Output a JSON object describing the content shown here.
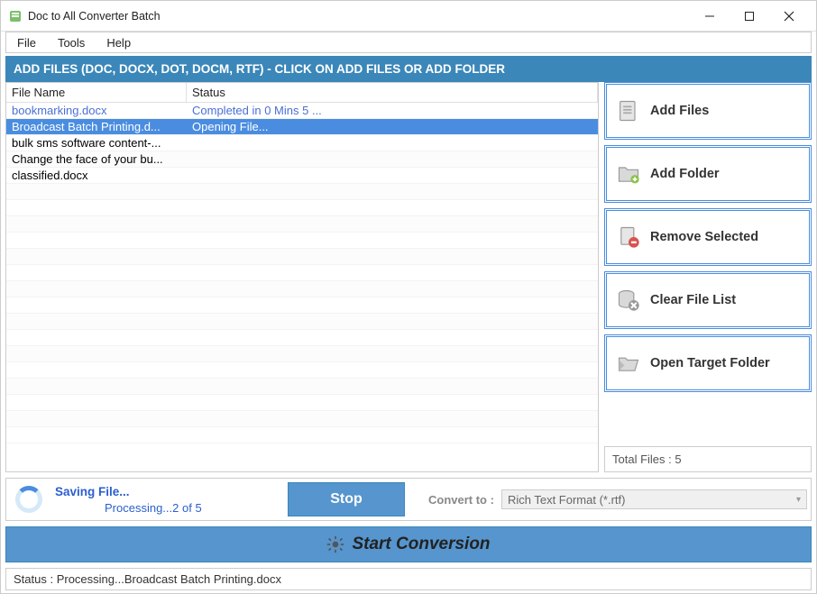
{
  "window": {
    "title": "Doc to All Converter Batch"
  },
  "menu": {
    "items": [
      "File",
      "Tools",
      "Help"
    ]
  },
  "header": {
    "text": "ADD FILES (DOC, DOCX, DOT, DOCM, RTF) - CLICK ON ADD FILES OR ADD FOLDER"
  },
  "table": {
    "columns": {
      "name": "File Name",
      "status": "Status"
    },
    "rows": [
      {
        "name": "bookmarking.docx",
        "status": "Completed in 0 Mins 5 ...",
        "state": "completed"
      },
      {
        "name": "Broadcast Batch Printing.d...",
        "status": "Opening File...",
        "state": "selected"
      },
      {
        "name": "bulk sms software content-...",
        "status": "",
        "state": ""
      },
      {
        "name": "Change the face of your bu...",
        "status": "",
        "state": ""
      },
      {
        "name": "classified.docx",
        "status": "",
        "state": ""
      }
    ]
  },
  "actions": {
    "add_files": "Add Files",
    "add_folder": "Add Folder",
    "remove_selected": "Remove Selected",
    "clear_list": "Clear File List",
    "open_target": "Open Target Folder"
  },
  "total_files": {
    "label": "Total Files : 5"
  },
  "progress": {
    "saving": "Saving File...",
    "processing": "Processing...2 of 5",
    "stop": "Stop",
    "convert_label": "Convert to :",
    "convert_value": "Rich Text Format (*.rtf)"
  },
  "start": {
    "label": "Start Conversion"
  },
  "status": {
    "text": "Status  :  Processing...Broadcast Batch Printing.docx"
  }
}
